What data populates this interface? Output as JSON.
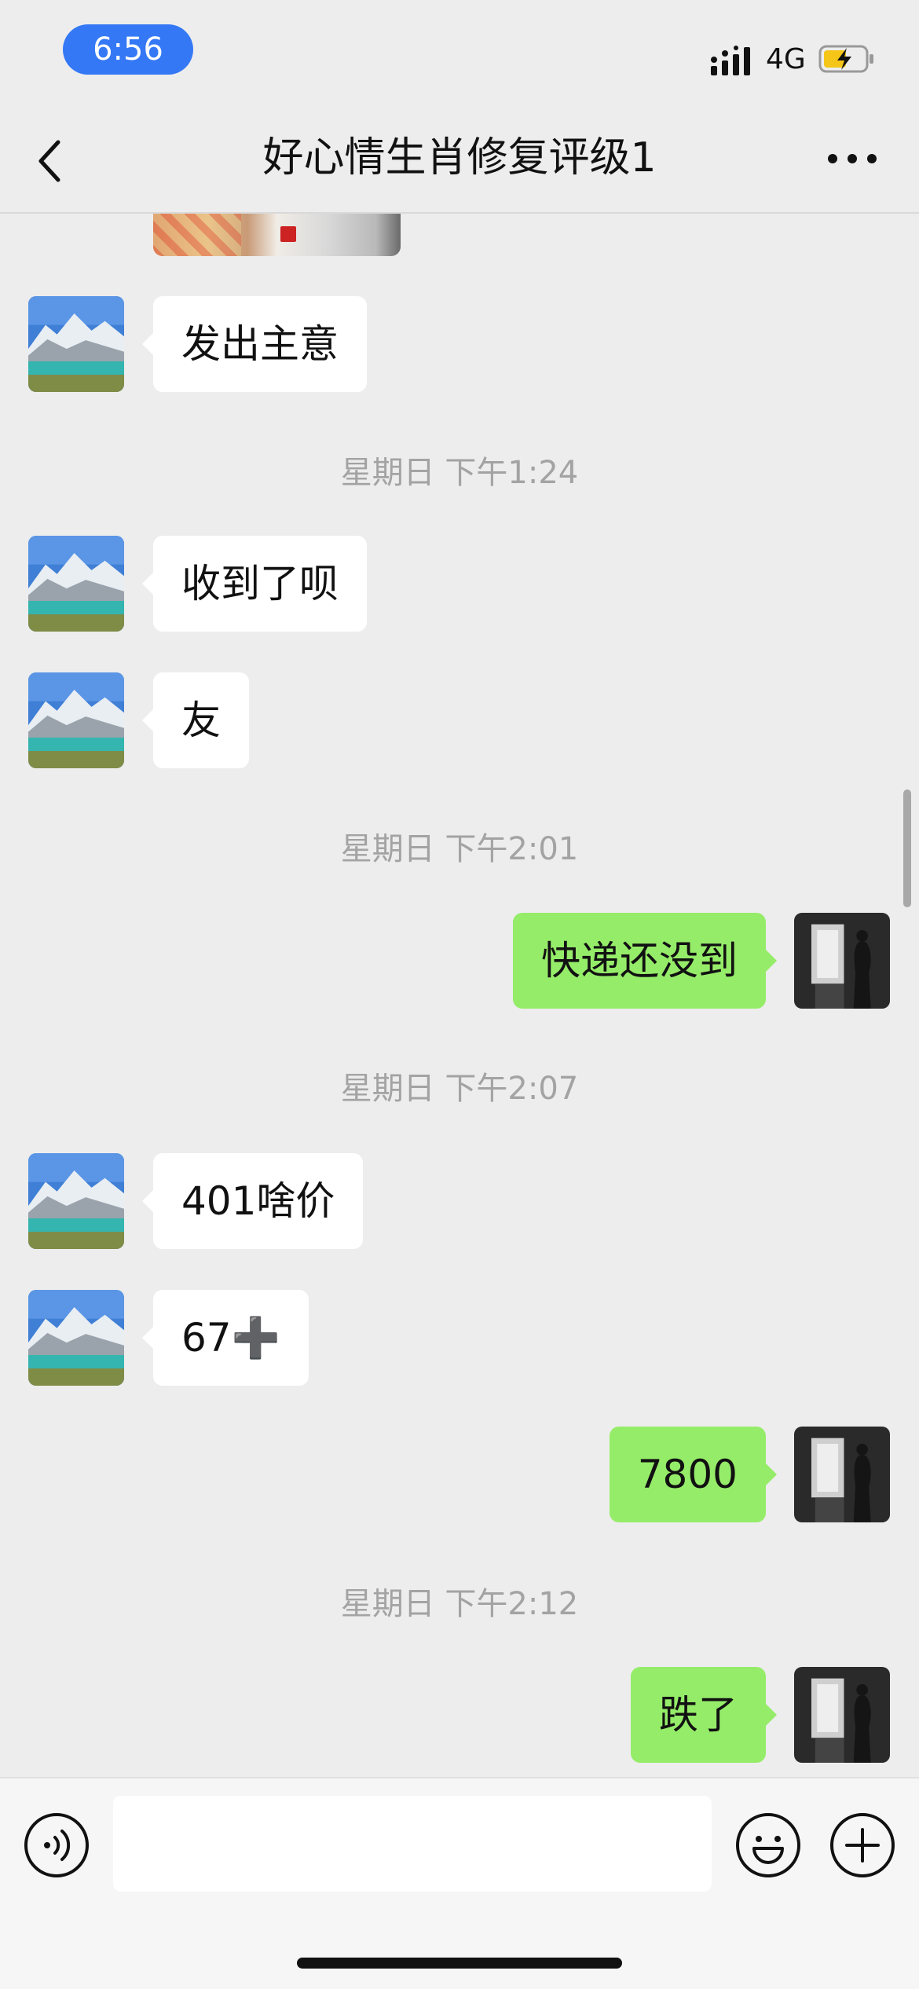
{
  "status_bar": {
    "time": "6:56",
    "network": "4G",
    "icons": [
      "signal-icon",
      "battery-charging-icon"
    ]
  },
  "nav": {
    "title": "好心情生肖修复评级1",
    "back_icon": "chevron-left-icon",
    "more_icon": "ellipsis-icon"
  },
  "messages": [
    {
      "kind": "image",
      "side": "in"
    },
    {
      "kind": "text",
      "side": "in",
      "text": "发出主意"
    },
    {
      "kind": "time",
      "text": "星期日 下午1:24"
    },
    {
      "kind": "text",
      "side": "in",
      "text": "收到了呗"
    },
    {
      "kind": "text",
      "side": "in",
      "text": "友"
    },
    {
      "kind": "time",
      "text": "星期日 下午2:01"
    },
    {
      "kind": "text",
      "side": "out",
      "text": "快递还没到"
    },
    {
      "kind": "time",
      "text": "星期日 下午2:07"
    },
    {
      "kind": "text",
      "side": "in",
      "text": "401啥价"
    },
    {
      "kind": "text",
      "side": "in",
      "text": "67",
      "suffix": "➕"
    },
    {
      "kind": "text",
      "side": "out",
      "text": "7800"
    },
    {
      "kind": "time",
      "text": "星期日 下午2:12"
    },
    {
      "kind": "text",
      "side": "out",
      "text": "跌了"
    }
  ],
  "input_bar": {
    "value": "",
    "placeholder": "",
    "icons": [
      "voice-icon",
      "emoji-icon",
      "add-icon"
    ]
  },
  "colors": {
    "background": "#ededed",
    "outgoing_bubble": "#95ec69",
    "incoming_bubble": "#ffffff",
    "time_pill": "#3478f6",
    "timestamp_text": "#a3a3a3"
  }
}
